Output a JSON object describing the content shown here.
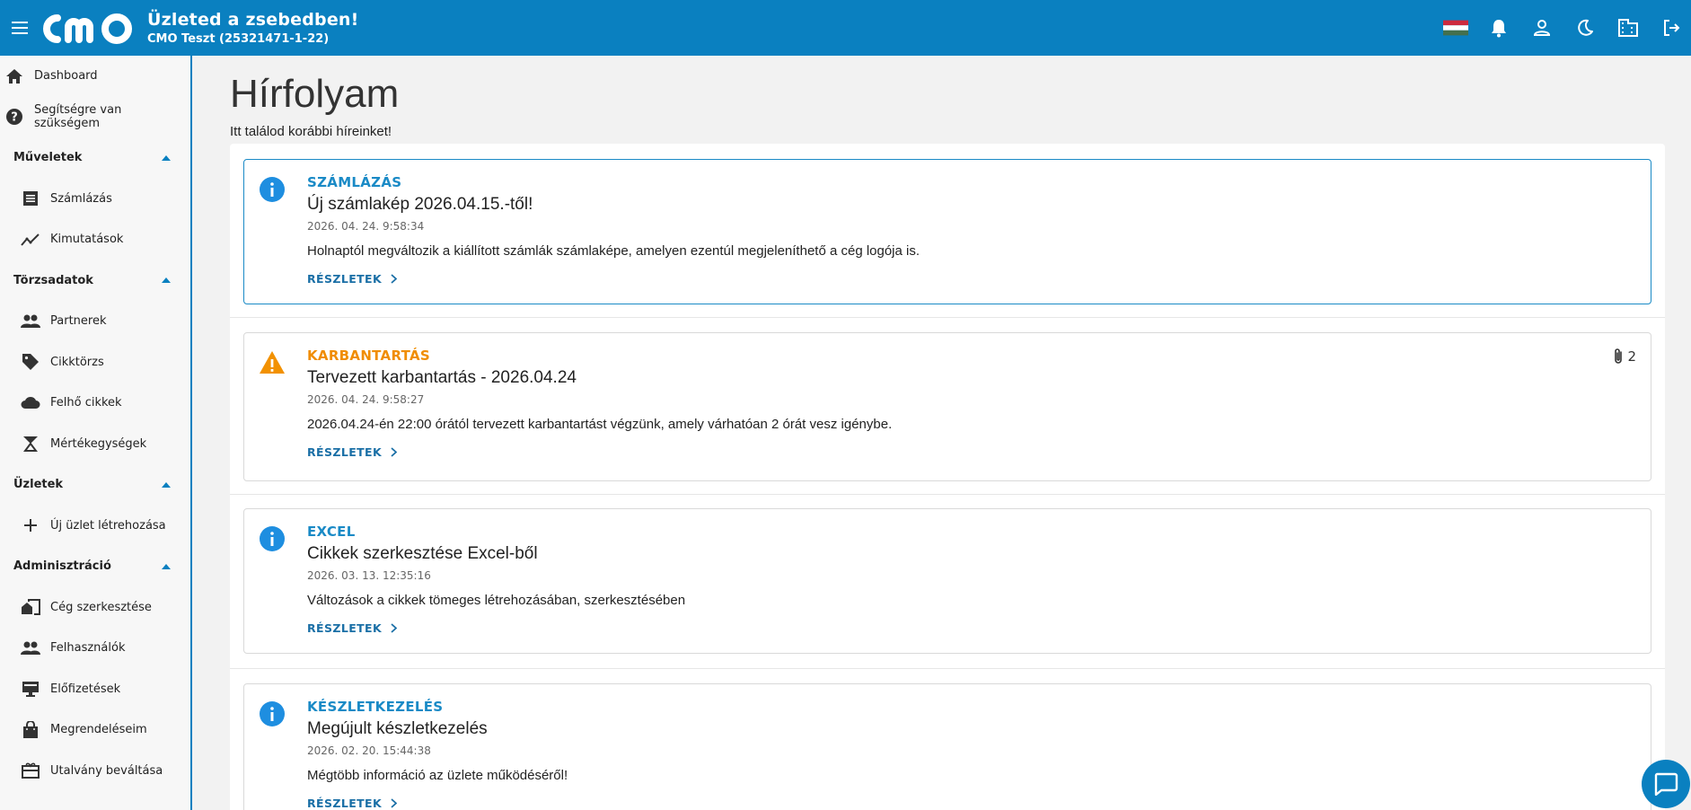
{
  "header": {
    "title": "Üzleted a zsebedben!",
    "company": "CMO Teszt (25321471-1-22)",
    "logo_text": "cmo",
    "accent": "#0a80c0"
  },
  "sidebar": {
    "dashboard": "Dashboard",
    "help": "Segítségre van szükségem",
    "groups": {
      "muveletek": "Műveletek",
      "torzsadatok": "Törzsadatok",
      "uzletek": "Üzletek",
      "adminisztracio": "Adminisztráció"
    },
    "items": {
      "szamlazas": "Számlázás",
      "kimutatasok": "Kimutatások",
      "partnerek": "Partnerek",
      "cikktorzs": "Cikktörzs",
      "felho": "Felhő cikkek",
      "mertekegysegek": "Mértékegységek",
      "uj_uzlet": "Új üzlet létrehozása",
      "ceg": "Cég szerkesztése",
      "felhasznalok": "Felhasználók",
      "elofizetesek": "Előfizetések",
      "megrendeleseim": "Megrendeléseim",
      "utalvany": "Utalvány beváltása"
    }
  },
  "main": {
    "title": "Hírfolyam",
    "subtitle": "Itt találod korábbi híreinket!",
    "more_label": "RÉSZLETEK",
    "news": [
      {
        "category": "SZÁMLÁZÁS",
        "title": "Új számlakép 2026.04.15.-től!",
        "date": "2026. 04. 24. 9:58:34",
        "text": "Holnaptól megváltozik a kiállított számlák számlaképe, amelyen ezentúl megjeleníthető a cég logója is.",
        "icon": "info-icon"
      },
      {
        "category": "KARBANTARTÁS",
        "title": "Tervezett karbantartás - 2026.04.24",
        "date": "2026. 04. 24. 9:58:27",
        "text": "2026.04.24-én 22:00 órától tervezett karbantartást végzünk, amely várhatóan 2 órát vesz igénybe.",
        "icon": "warning-icon",
        "attachments": "2"
      },
      {
        "category": "EXCEL",
        "title": "Cikkek szerkesztése Excel-ből",
        "date": "2026. 03. 13. 12:35:16",
        "text": "Változások a cikkek tömeges létrehozásában, szerkesztésében",
        "icon": "info-icon"
      },
      {
        "category": "KÉSZLETKEZELÉS",
        "title": "Megújult készletkezelés",
        "date": "2026. 02. 20. 15:44:38",
        "text": "Mégtöbb információ az üzlete működéséről!",
        "icon": "info-icon"
      }
    ]
  }
}
